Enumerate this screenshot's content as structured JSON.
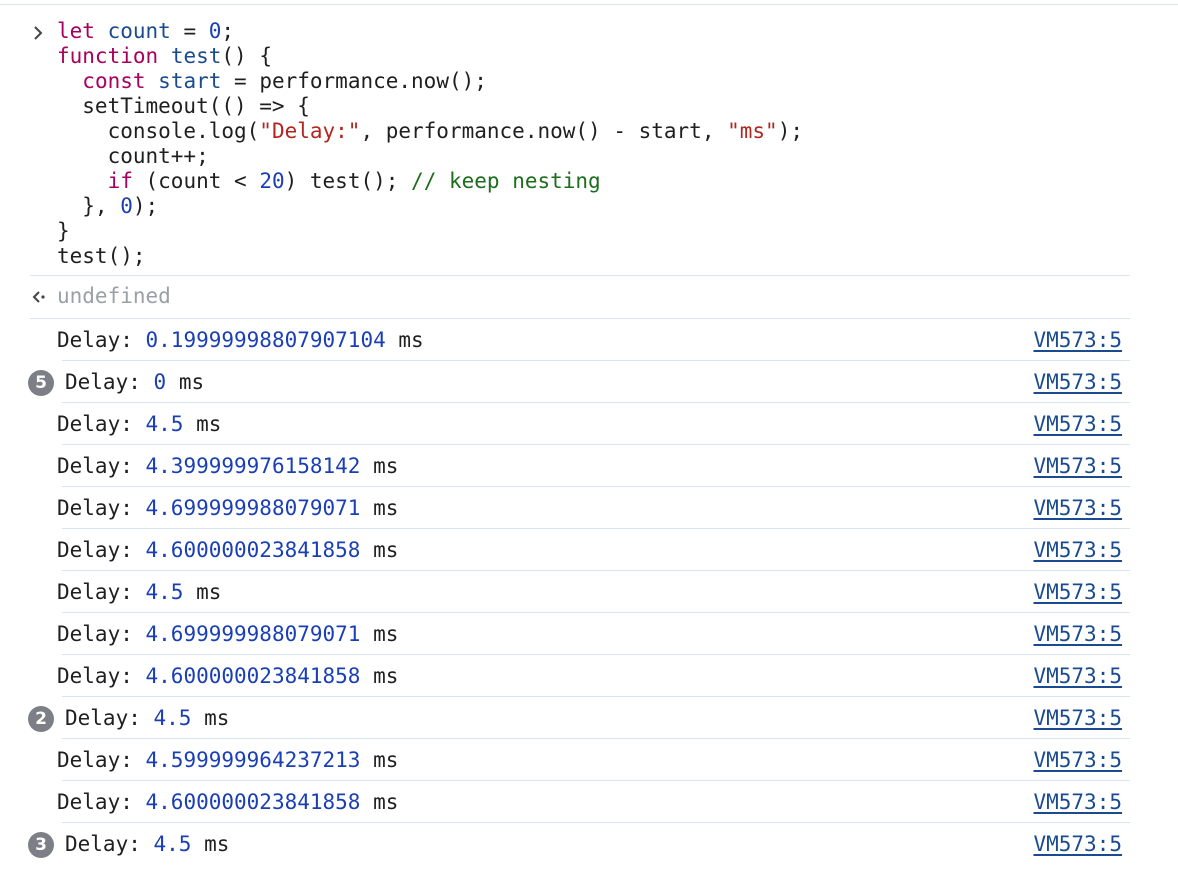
{
  "input": {
    "code_lines": [
      [
        {
          "t": "let",
          "c": "kw"
        },
        {
          "t": " "
        },
        {
          "t": "count",
          "c": "var"
        },
        {
          "t": " = "
        },
        {
          "t": "0",
          "c": "num"
        },
        {
          "t": ";"
        }
      ],
      [
        {
          "t": "function",
          "c": "kw"
        },
        {
          "t": " "
        },
        {
          "t": "test",
          "c": "var"
        },
        {
          "t": "() {"
        }
      ],
      [
        {
          "t": "  "
        },
        {
          "t": "const",
          "c": "kw"
        },
        {
          "t": " "
        },
        {
          "t": "start",
          "c": "var"
        },
        {
          "t": " = performance.now();"
        }
      ],
      [
        {
          "t": "  setTimeout(() => {"
        }
      ],
      [
        {
          "t": "    console.log("
        },
        {
          "t": "\"Delay:\"",
          "c": "str"
        },
        {
          "t": ", performance.now() - start, "
        },
        {
          "t": "\"ms\"",
          "c": "str"
        },
        {
          "t": ");"
        }
      ],
      [
        {
          "t": "    count++;"
        }
      ],
      [
        {
          "t": "    "
        },
        {
          "t": "if",
          "c": "kw"
        },
        {
          "t": " (count < "
        },
        {
          "t": "20",
          "c": "num"
        },
        {
          "t": ") test(); "
        },
        {
          "t": "// keep nesting",
          "c": "cmt"
        }
      ],
      [
        {
          "t": "  }, "
        },
        {
          "t": "0",
          "c": "num"
        },
        {
          "t": ");"
        }
      ],
      [
        {
          "t": "}"
        }
      ],
      [
        {
          "t": "test();"
        }
      ]
    ]
  },
  "result": {
    "text": "undefined"
  },
  "logs": [
    {
      "label": "Delay:",
      "value": "0.19999998807907104",
      "unit": "ms",
      "source": "VM573:5"
    },
    {
      "label": "Delay:",
      "value": "0",
      "unit": "ms",
      "source": "VM573:5",
      "count": "5"
    },
    {
      "label": "Delay:",
      "value": "4.5",
      "unit": "ms",
      "source": "VM573:5"
    },
    {
      "label": "Delay:",
      "value": "4.399999976158142",
      "unit": "ms",
      "source": "VM573:5"
    },
    {
      "label": "Delay:",
      "value": "4.699999988079071",
      "unit": "ms",
      "source": "VM573:5"
    },
    {
      "label": "Delay:",
      "value": "4.600000023841858",
      "unit": "ms",
      "source": "VM573:5"
    },
    {
      "label": "Delay:",
      "value": "4.5",
      "unit": "ms",
      "source": "VM573:5"
    },
    {
      "label": "Delay:",
      "value": "4.699999988079071",
      "unit": "ms",
      "source": "VM573:5"
    },
    {
      "label": "Delay:",
      "value": "4.600000023841858",
      "unit": "ms",
      "source": "VM573:5"
    },
    {
      "label": "Delay:",
      "value": "4.5",
      "unit": "ms",
      "source": "VM573:5",
      "count": "2"
    },
    {
      "label": "Delay:",
      "value": "4.599999964237213",
      "unit": "ms",
      "source": "VM573:5"
    },
    {
      "label": "Delay:",
      "value": "4.600000023841858",
      "unit": "ms",
      "source": "VM573:5"
    },
    {
      "label": "Delay:",
      "value": "4.5",
      "unit": "ms",
      "source": "VM573:5",
      "count": "3"
    }
  ]
}
